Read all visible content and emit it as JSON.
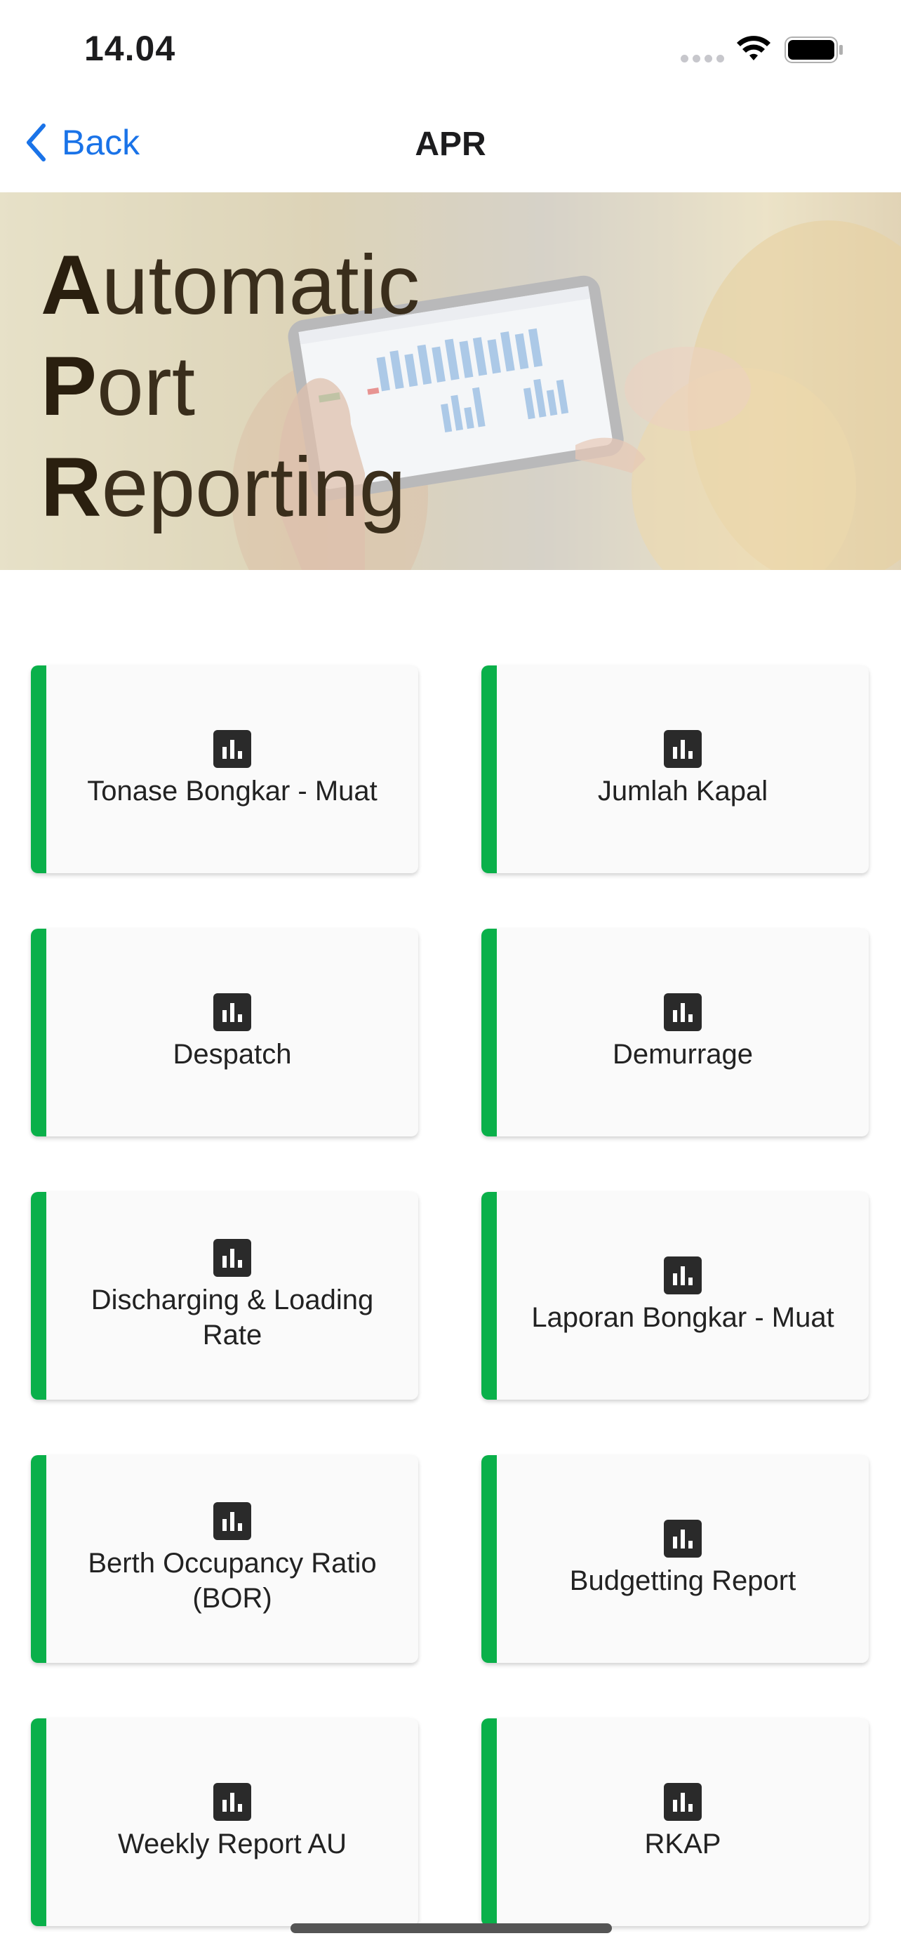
{
  "status_bar": {
    "time": "14.04"
  },
  "nav": {
    "back_label": "Back",
    "title": "APR"
  },
  "banner": {
    "line1_initial": "A",
    "line1_rest": "utomatic",
    "line2_initial": "P",
    "line2_rest": "ort",
    "line3_initial": "R",
    "line3_rest": "eporting"
  },
  "accent_color": "#0ab04a",
  "menu": [
    {
      "label": "Tonase Bongkar - Muat",
      "icon": "bar-chart-icon"
    },
    {
      "label": "Jumlah Kapal",
      "icon": "bar-chart-icon"
    },
    {
      "label": "Despatch",
      "icon": "bar-chart-icon"
    },
    {
      "label": "Demurrage",
      "icon": "bar-chart-icon"
    },
    {
      "label": "Discharging & Loading Rate",
      "icon": "bar-chart-icon"
    },
    {
      "label": "Laporan Bongkar - Muat",
      "icon": "bar-chart-icon"
    },
    {
      "label": "Berth Occupancy Ratio (BOR)",
      "icon": "bar-chart-icon"
    },
    {
      "label": "Budgetting Report",
      "icon": "bar-chart-icon"
    },
    {
      "label": "Weekly Report AU",
      "icon": "bar-chart-icon"
    },
    {
      "label": "RKAP",
      "icon": "bar-chart-icon"
    }
  ]
}
